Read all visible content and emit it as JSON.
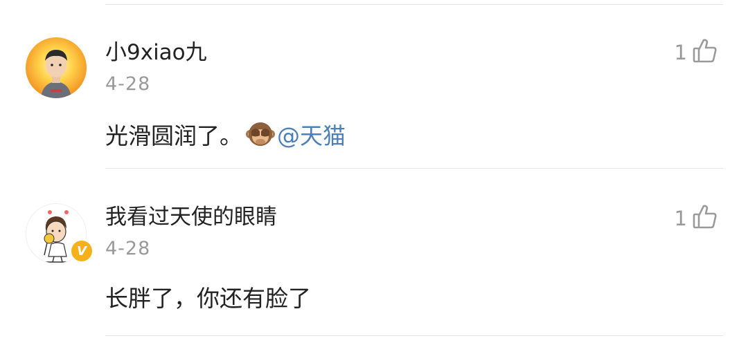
{
  "comments": [
    {
      "username": "小9xiao九",
      "date": "4-28",
      "text": "光滑圆润了。",
      "emoji": "see-no-evil-monkey",
      "mention": "@天猫",
      "likes": "1"
    },
    {
      "username": "我看过天使的眼睛",
      "date": "4-28",
      "text": "长胖了，你还有脸了",
      "verified": true,
      "verified_label": "V",
      "likes": "1"
    }
  ],
  "colors": {
    "mention": "#4d7fb8",
    "verified_badge": "#f6b11a",
    "meta_gray": "#999999"
  }
}
